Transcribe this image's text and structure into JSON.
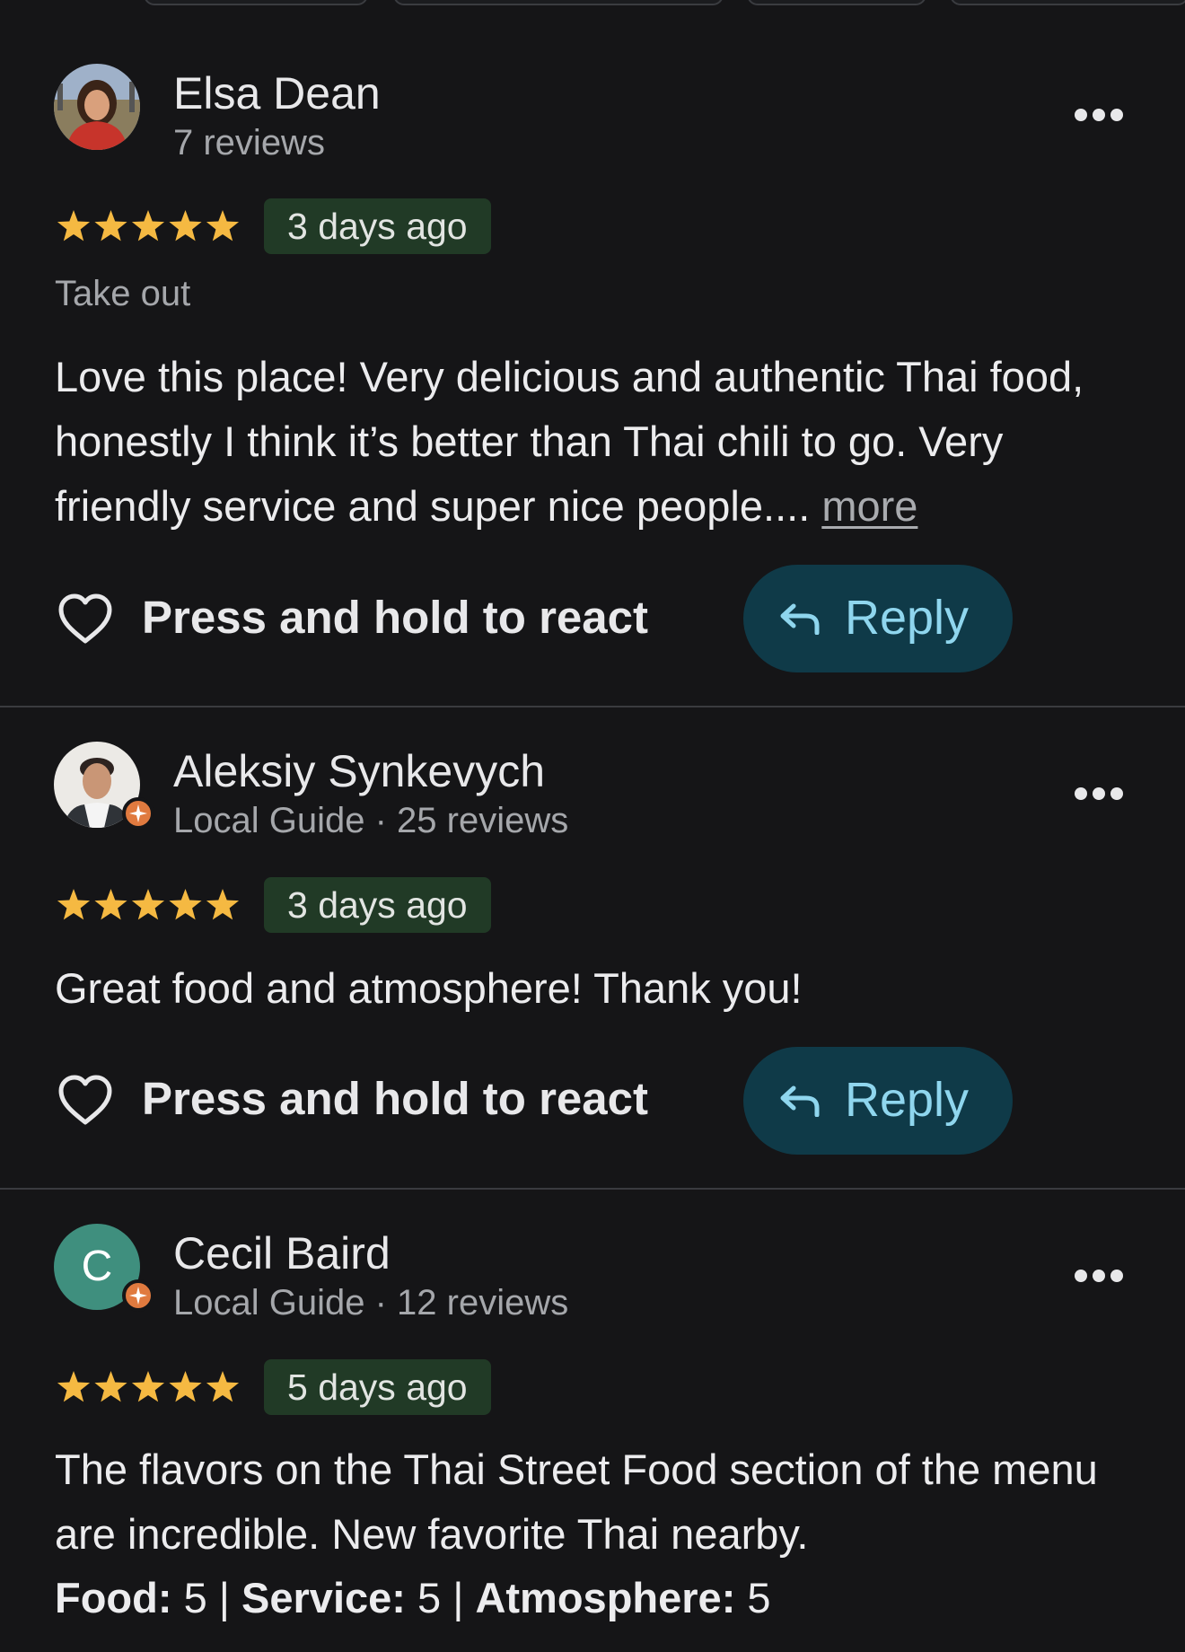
{
  "reviews": [
    {
      "name": "Elsa Dean",
      "meta": "7 reviews",
      "rating": 5,
      "rating_max": 5,
      "date": "3 days ago",
      "service_tag": "Take out",
      "text": "Love this place! Very delicious and authentic Thai food, honestly I think it’s better than Thai chili to go. Very friendly service and super nice people.... ",
      "more_label": "more",
      "react_label": "Press and hold to react",
      "reply_label": "Reply"
    },
    {
      "name": "Aleksiy Synkevych",
      "meta": "Local Guide · 25 reviews",
      "rating": 5,
      "rating_max": 5,
      "date": "3 days ago",
      "text": "Great food and atmosphere! Thank you!",
      "react_label": "Press and hold to react",
      "reply_label": "Reply"
    },
    {
      "name": "Cecil Baird",
      "avatar_initial": "C",
      "meta": "Local Guide · 12 reviews",
      "rating": 5,
      "rating_max": 5,
      "date": "5 days ago",
      "text": "The flavors on the Thai Street Food section of the menu are incredible. New favorite Thai nearby.",
      "sub_ratings": [
        {
          "label": "Food:",
          "value": "5"
        },
        {
          "label": "Service:",
          "value": "5"
        },
        {
          "label": "Atmosphere:",
          "value": "5"
        }
      ],
      "sub_separator": " | "
    }
  ],
  "colors": {
    "background": "#151517",
    "star": "#f5b942",
    "date_badge_bg": "#213a26",
    "reply_bg": "#0f3a48",
    "reply_text": "#8fd6ee",
    "local_guide_badge": "#e07a3f",
    "initial_avatar_bg": "#3f8f7e"
  },
  "icons": {
    "more": "more-horizontal-icon",
    "heart": "heart-outline-icon",
    "reply": "reply-arrow-icon",
    "star": "star-icon",
    "local_guide": "local-guide-badge-icon"
  }
}
